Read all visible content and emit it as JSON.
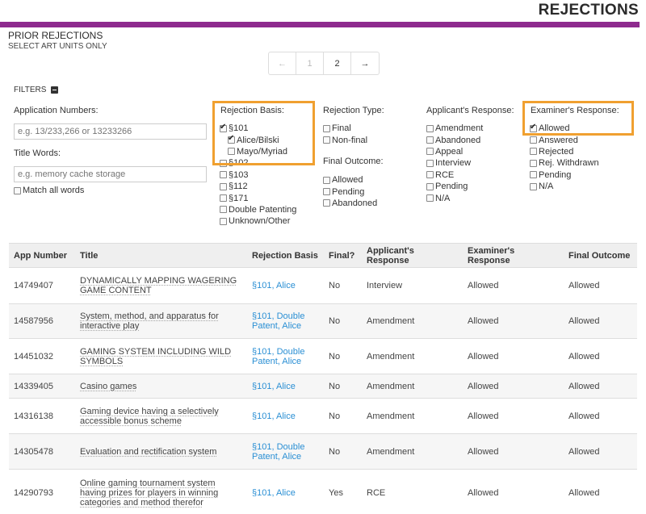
{
  "header": {
    "title": "REJECTIONS",
    "accent_color": "#8e2a8e"
  },
  "section": {
    "title": "PRIOR REJECTIONS",
    "subtitle": "SELECT ART UNITS ONLY"
  },
  "pager": {
    "prev": "←",
    "pages": [
      "1",
      "2"
    ],
    "next": "→",
    "current": "2"
  },
  "filters": {
    "label": "FILTERS",
    "app_numbers": {
      "label": "Application Numbers:",
      "placeholder": "e.g. 13/233,266 or 13233266"
    },
    "title_words": {
      "label": "Title Words:",
      "placeholder": "e.g. memory cache storage",
      "match_all": "Match all words"
    },
    "rejection_basis": {
      "label": "Rejection Basis:",
      "options": [
        {
          "label": "§101",
          "checked": true
        },
        {
          "label": "Alice/Bilski",
          "checked": true
        },
        {
          "label": "Mayo/Myriad",
          "checked": false
        },
        {
          "label": "§102",
          "checked": false
        },
        {
          "label": "§103",
          "checked": false
        },
        {
          "label": "§112",
          "checked": false
        },
        {
          "label": "§171",
          "checked": false
        },
        {
          "label": "Double Patenting",
          "checked": false
        },
        {
          "label": "Unknown/Other",
          "checked": false
        }
      ]
    },
    "rejection_type": {
      "label": "Rejection Type:",
      "options": [
        "Final",
        "Non-final"
      ]
    },
    "final_outcome": {
      "label": "Final Outcome:",
      "options": [
        "Allowed",
        "Pending",
        "Abandoned"
      ]
    },
    "applicant_response": {
      "label": "Applicant's Response:",
      "options": [
        "Amendment",
        "Abandoned",
        "Appeal",
        "Interview",
        "RCE",
        "Pending",
        "N/A"
      ]
    },
    "examiner_response": {
      "label": "Examiner's Response:",
      "options": [
        {
          "label": "Allowed",
          "checked": true
        },
        {
          "label": "Answered",
          "checked": false
        },
        {
          "label": "Rejected",
          "checked": false
        },
        {
          "label": "Rej. Withdrawn",
          "checked": false
        },
        {
          "label": "Pending",
          "checked": false
        },
        {
          "label": "N/A",
          "checked": false
        }
      ]
    }
  },
  "table": {
    "headers": [
      "App Number",
      "Title",
      "Rejection Basis",
      "Final?",
      "Applicant's Response",
      "Examiner's Response",
      "Final Outcome"
    ],
    "rows": [
      [
        "14749407",
        "DYNAMICALLY MAPPING WAGERING GAME CONTENT",
        "§101, Alice",
        "No",
        "Interview",
        "Allowed",
        "Allowed"
      ],
      [
        "14587956",
        "System, method, and apparatus for interactive play",
        "§101, Double Patent, Alice",
        "No",
        "Amendment",
        "Allowed",
        "Allowed"
      ],
      [
        "14451032",
        "GAMING SYSTEM INCLUDING WILD SYMBOLS",
        "§101, Double Patent, Alice",
        "No",
        "Amendment",
        "Allowed",
        "Allowed"
      ],
      [
        "14339405",
        "Casino games",
        "§101, Alice",
        "No",
        "Amendment",
        "Allowed",
        "Allowed"
      ],
      [
        "14316138",
        "Gaming device having a selectively accessible bonus scheme",
        "§101, Alice",
        "No",
        "Amendment",
        "Allowed",
        "Allowed"
      ],
      [
        "14305478",
        "Evaluation and rectification system",
        "§101, Double Patent, Alice",
        "No",
        "Amendment",
        "Allowed",
        "Allowed"
      ],
      [
        "14290793",
        "Online gaming tournament system having prizes for players in winning categories and method therefor",
        "§101, Alice",
        "Yes",
        "RCE",
        "Allowed",
        "Allowed"
      ]
    ]
  }
}
